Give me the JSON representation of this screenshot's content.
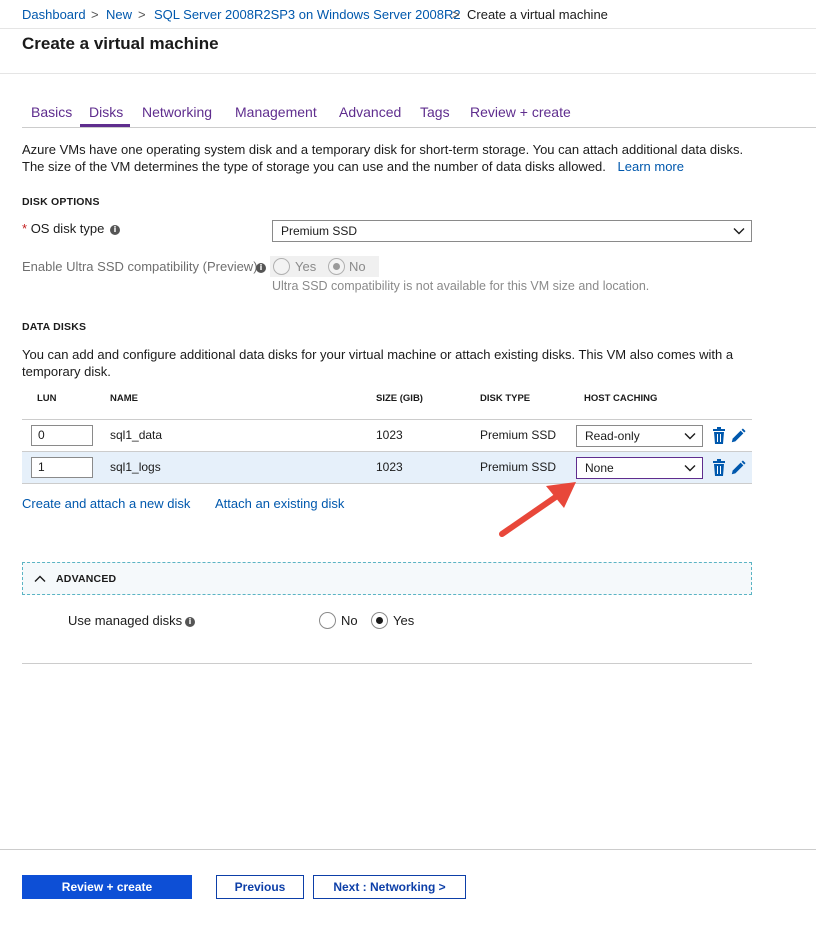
{
  "breadcrumb": {
    "items": [
      "Dashboard",
      "New",
      "SQL Server 2008R2SP3 on Windows Server 2008R2"
    ],
    "current": "Create a virtual machine",
    "separator": ">"
  },
  "page": {
    "title": "Create a virtual machine"
  },
  "tabs": [
    {
      "label": "Basics"
    },
    {
      "label": "Disks"
    },
    {
      "label": "Networking"
    },
    {
      "label": "Management"
    },
    {
      "label": "Advanced"
    },
    {
      "label": "Tags"
    },
    {
      "label": "Review + create"
    }
  ],
  "active_tab": "Disks",
  "intro": {
    "line1": "Azure VMs have one operating system disk and a temporary disk for short-term storage. You can attach additional data disks.",
    "line2": "The size of the VM determines the type of storage you can use and the number of data disks allowed.",
    "learn_more": "Learn more"
  },
  "disk_options": {
    "heading": "DISK OPTIONS",
    "required_mark": "*",
    "os_disk_label": "OS disk type",
    "os_disk_value": "Premium SSD",
    "ultra_label": "Enable Ultra SSD compatibility (Preview)",
    "ultra_yes": "Yes",
    "ultra_no": "No",
    "ultra_selected": "No",
    "ultra_note": "Ultra SSD compatibility is not available for this VM size and location."
  },
  "data_disks": {
    "heading": "DATA DISKS",
    "description_line1": "You can add and configure additional data disks for your virtual machine or attach existing disks. This VM also comes with a",
    "description_line2": "temporary disk.",
    "columns": [
      "LUN",
      "NAME",
      "SIZE (GIB)",
      "DISK TYPE",
      "HOST CACHING"
    ],
    "rows": [
      {
        "lun": "0",
        "name": "sql1_data",
        "size": "1023",
        "type": "Premium SSD",
        "caching": "Read-only"
      },
      {
        "lun": "1",
        "name": "sql1_logs",
        "size": "1023",
        "type": "Premium SSD",
        "caching": "None"
      }
    ],
    "create_link": "Create and attach a new disk",
    "attach_link": "Attach an existing disk"
  },
  "advanced": {
    "heading": "ADVANCED",
    "managed_label": "Use managed disks",
    "no": "No",
    "yes": "Yes",
    "selected": "Yes"
  },
  "footer": {
    "review_create": "Review + create",
    "previous": "Previous",
    "next": "Next : Networking >"
  },
  "colors": {
    "accent_purple": "#5f2d8e",
    "link_blue": "#0058ad",
    "primary_button": "#0d4fd6",
    "annotation_arrow": "#e8473a",
    "selected_row": "#e6f0fa"
  },
  "icons": [
    "chevron-right-icon",
    "info-icon",
    "chevron-down-icon",
    "trash-icon",
    "pencil-icon",
    "chevron-up-icon",
    "arrow-annotation"
  ]
}
